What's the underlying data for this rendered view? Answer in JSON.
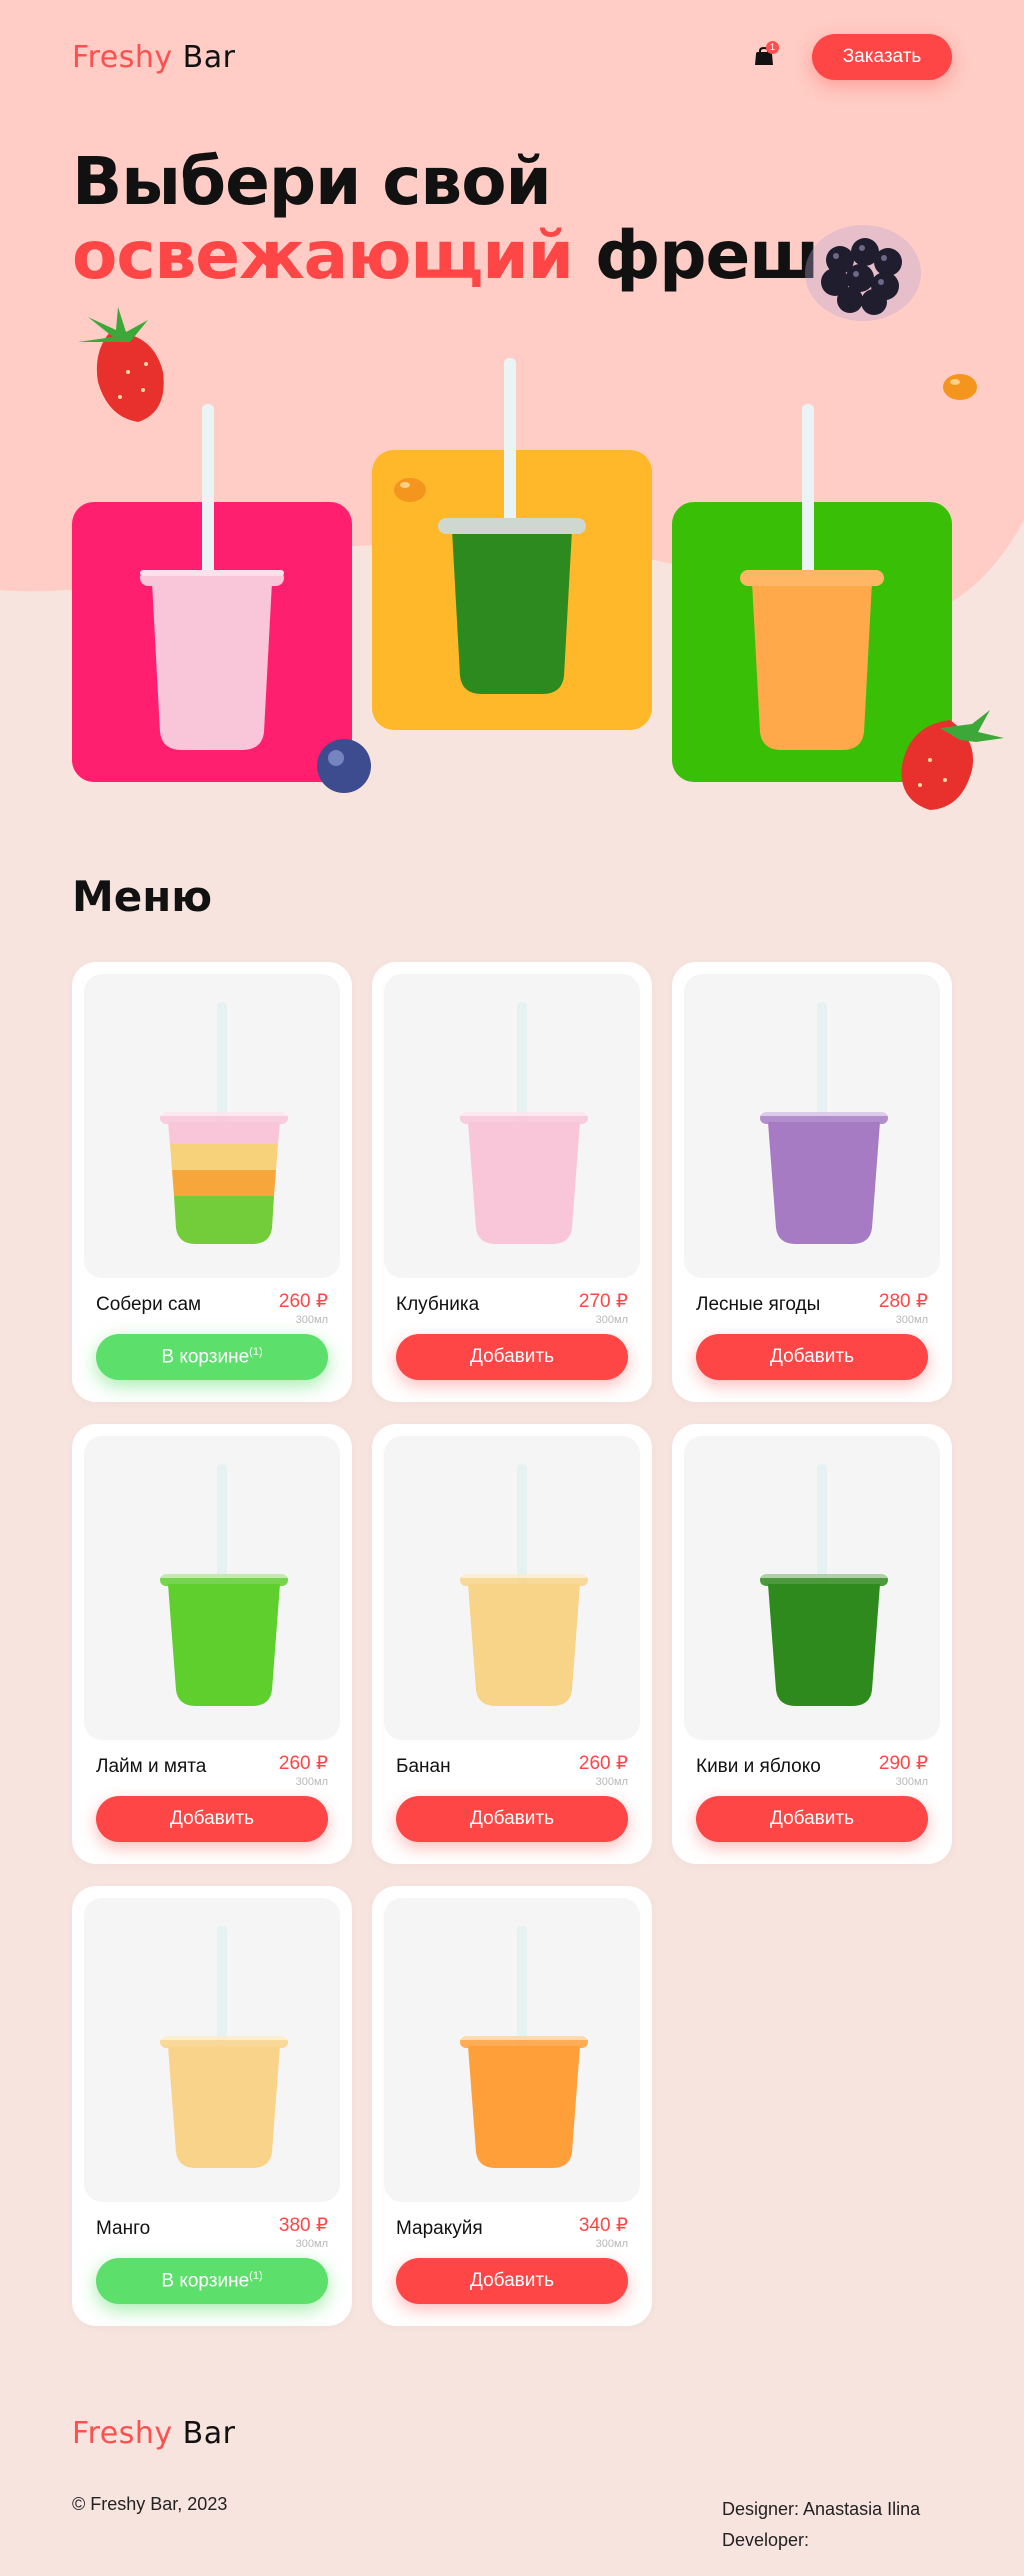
{
  "brand": {
    "name_part1": "Freshy",
    "name_part2": "Bar"
  },
  "header": {
    "cart_count": "1",
    "order_label": "Заказать"
  },
  "hero": {
    "title_line1": "Выбери свой",
    "title_accent": "освежающий",
    "title_rest": "фреш"
  },
  "hero_cards": [
    {
      "color": "#ff1f6e",
      "drink": "#f8c6d8"
    },
    {
      "color": "#ffb82a",
      "drink": "#2d8a1f"
    },
    {
      "color": "#39c006",
      "drink": "#ffa94a"
    }
  ],
  "menu": {
    "title": "Меню",
    "items": [
      {
        "name": "Собери сам",
        "price": "260 ₽",
        "volume": "300мл",
        "button": "В корзине",
        "count": "(1)",
        "in_cart": true,
        "drink": "layered"
      },
      {
        "name": "Клубника",
        "price": "270 ₽",
        "volume": "300мл",
        "button": "Добавить",
        "in_cart": false,
        "drink": "#f8c6d8"
      },
      {
        "name": "Лесные ягоды",
        "price": "280 ₽",
        "volume": "300мл",
        "button": "Добавить",
        "in_cart": false,
        "drink": "#a77bc4"
      },
      {
        "name": "Лайм и мята",
        "price": "260 ₽",
        "volume": "300мл",
        "button": "Добавить",
        "in_cart": false,
        "drink": "#5fcf2e"
      },
      {
        "name": "Банан",
        "price": "260 ₽",
        "volume": "300мл",
        "button": "Добавить",
        "in_cart": false,
        "drink": "#f7d488"
      },
      {
        "name": "Киви и яблоко",
        "price": "290 ₽",
        "volume": "300мл",
        "button": "Добавить",
        "in_cart": false,
        "drink": "#2e8a1c"
      },
      {
        "name": "Манго",
        "price": "380 ₽",
        "volume": "300мл",
        "button": "В корзине",
        "count": "(1)",
        "in_cart": true,
        "drink": "#f9d389"
      },
      {
        "name": "Маракуйя",
        "price": "340 ₽",
        "volume": "300мл",
        "button": "Добавить",
        "in_cart": false,
        "drink": "#ff9f3a"
      }
    ]
  },
  "footer": {
    "copyright": "© Freshy Bar, 2023",
    "designer": "Designer: Anastasia Ilina",
    "developer": "Developer:"
  },
  "colors": {
    "accent": "#ff4646",
    "in_cart": "#5ddf6b",
    "hero_bg": "#ffcdc5",
    "page_bg": "#f8e4de"
  }
}
